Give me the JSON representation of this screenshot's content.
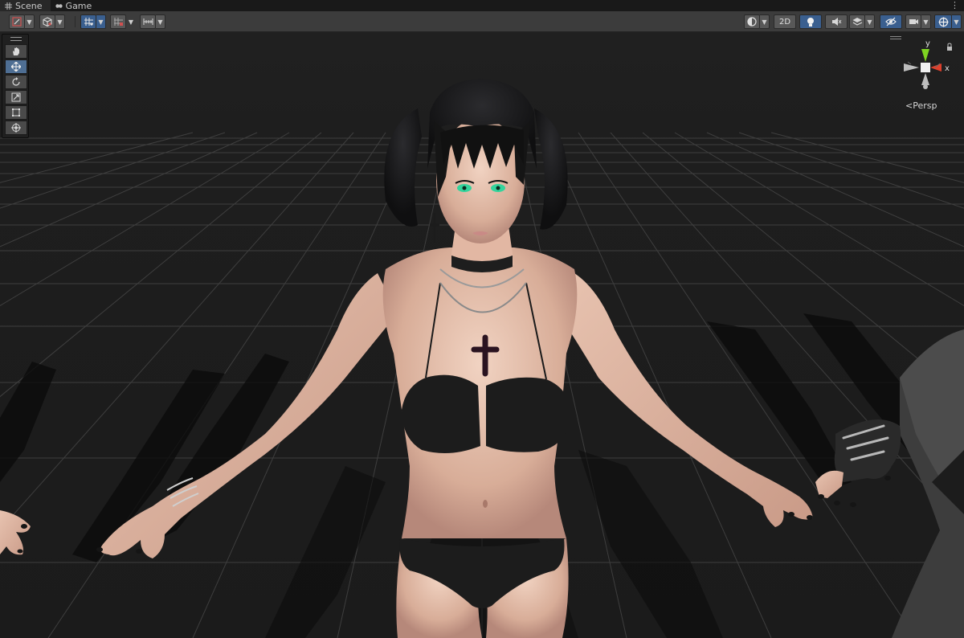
{
  "tabs": [
    {
      "label": "Scene",
      "icon": "grid-icon",
      "active": true
    },
    {
      "label": "Game",
      "icon": "gamepad-icon",
      "active": false
    }
  ],
  "toolbar": {
    "right": {
      "mode_2d_label": "2D"
    }
  },
  "tools_panel": {
    "tools": [
      {
        "name": "hand-tool",
        "icon": "hand-icon",
        "active": false
      },
      {
        "name": "move-tool",
        "icon": "move-icon",
        "active": true
      },
      {
        "name": "rotate-tool",
        "icon": "rotate-icon",
        "active": false
      },
      {
        "name": "scale-tool",
        "icon": "scale-icon",
        "active": false
      },
      {
        "name": "rect-tool",
        "icon": "rect-transform-icon",
        "active": false
      },
      {
        "name": "transform-tool",
        "icon": "transform-icon",
        "active": false
      }
    ]
  },
  "gizmo": {
    "axis_y": "y",
    "axis_x": "x",
    "projection_label": "Persp"
  },
  "colors": {
    "accent": "#3a5f8f",
    "toolbar": "#3c3c3c",
    "axis_x": "#e0402c",
    "axis_y": "#7ed321"
  }
}
